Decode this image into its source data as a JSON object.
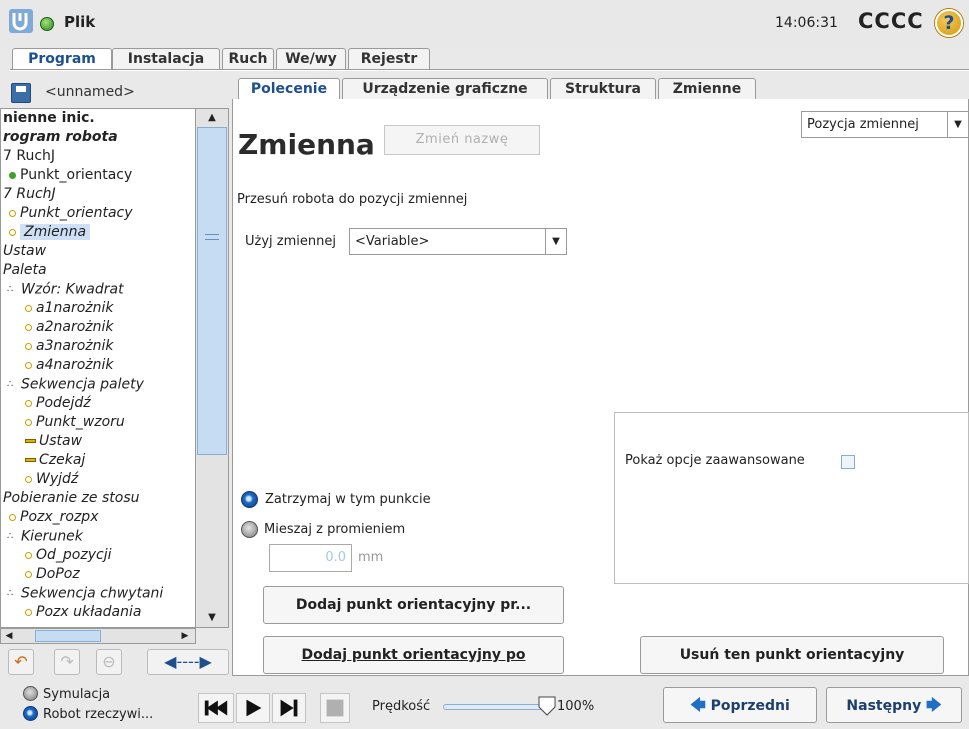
{
  "header": {
    "file_label": "Plik",
    "clock": "14:06:31",
    "robot_name": "CCCC",
    "help_glyph": "?"
  },
  "main_tabs": [
    {
      "label": "Program"
    },
    {
      "label": "Instalacja"
    },
    {
      "label": "Ruch"
    },
    {
      "label": "We/wy"
    },
    {
      "label": "Rejestr"
    }
  ],
  "program": {
    "name": "<unnamed>"
  },
  "tree": [
    {
      "text": "nienne inic.",
      "style": "bold",
      "marker": ""
    },
    {
      "text": "rogram robota",
      "style": "bold-ital",
      "marker": ""
    },
    {
      "text": "RuchJ",
      "style": "",
      "marker": "7 "
    },
    {
      "text": "Punkt_orientacy",
      "style": "",
      "marker": "dot-g"
    },
    {
      "text": "RuchJ",
      "style": "ital",
      "marker": "7 "
    },
    {
      "text": "Punkt_orientacy",
      "style": "ital",
      "marker": "dot-y"
    },
    {
      "text": "Zmienna",
      "style": "ital sel",
      "marker": "dot-y"
    },
    {
      "text": "Ustaw",
      "style": "ital",
      "marker": ""
    },
    {
      "text": "Paleta",
      "style": "ital",
      "marker": ""
    },
    {
      "text": "Wzór: Kwadrat",
      "style": "ital",
      "marker": "cluster"
    },
    {
      "text": "a1narożnik",
      "style": "ital",
      "marker": "dot-y"
    },
    {
      "text": "a2narożnik",
      "style": "ital",
      "marker": "dot-y"
    },
    {
      "text": "a3narożnik",
      "style": "ital",
      "marker": "dot-y"
    },
    {
      "text": "a4narożnik",
      "style": "ital",
      "marker": "dot-y"
    },
    {
      "text": "Sekwencja palety",
      "style": "ital",
      "marker": "cluster"
    },
    {
      "text": "Podejdź",
      "style": "ital",
      "marker": "dot-y"
    },
    {
      "text": "Punkt_wzoru",
      "style": "ital",
      "marker": "dot-y"
    },
    {
      "text": "Ustaw",
      "style": "ital",
      "marker": "dash-y"
    },
    {
      "text": "Czekaj",
      "style": "ital",
      "marker": "dash-y"
    },
    {
      "text": "Wyjdź",
      "style": "ital",
      "marker": "dot-y"
    },
    {
      "text": "Pobieranie ze stosu",
      "style": "ital",
      "marker": ""
    },
    {
      "text": "Pozx_rozpx",
      "style": "ital",
      "marker": "dot-y"
    },
    {
      "text": "Kierunek",
      "style": "ital",
      "marker": "cluster"
    },
    {
      "text": "Od_pozycji",
      "style": "ital",
      "marker": "dot-y"
    },
    {
      "text": "DoPoz",
      "style": "ital",
      "marker": "dot-y"
    },
    {
      "text": "Sekwencja chwytani",
      "style": "ital",
      "marker": "cluster"
    },
    {
      "text": "Pozx układania",
      "style": "ital",
      "marker": "dot-y"
    }
  ],
  "sub_tabs": [
    {
      "label": "Polecenie"
    },
    {
      "label": "Urządzenie graficzne"
    },
    {
      "label": "Struktura"
    },
    {
      "label": "Zmienne"
    }
  ],
  "command": {
    "title": "Zmienna",
    "rename_label": "Zmień nazwę",
    "position_select": "Pozycja zmiennej",
    "description": "Przesuń robota do pozycji zmiennej",
    "use_variable_label": "Użyj zmiennej",
    "use_variable_value": "<Variable>",
    "advanced_label": "Pokaż opcje zaawansowane",
    "stop_label": "Zatrzymaj w tym punkcie",
    "blend_label": "Mieszaj z promieniem",
    "radius_value": "0.0",
    "radius_unit": "mm",
    "add_before": "Dodaj punkt orientacyjny pr...",
    "add_after": "Dodaj punkt orientacyjny po",
    "remove": "Usuń ten punkt orientacyjny"
  },
  "bottom": {
    "mode_sim": "Symulacja",
    "mode_real": "Robot rzeczywi...",
    "speed_label": "Prędkość",
    "speed_value": "100%",
    "speed_fraction": 1.0,
    "prev": "Poprzedni",
    "next": "Następny"
  }
}
